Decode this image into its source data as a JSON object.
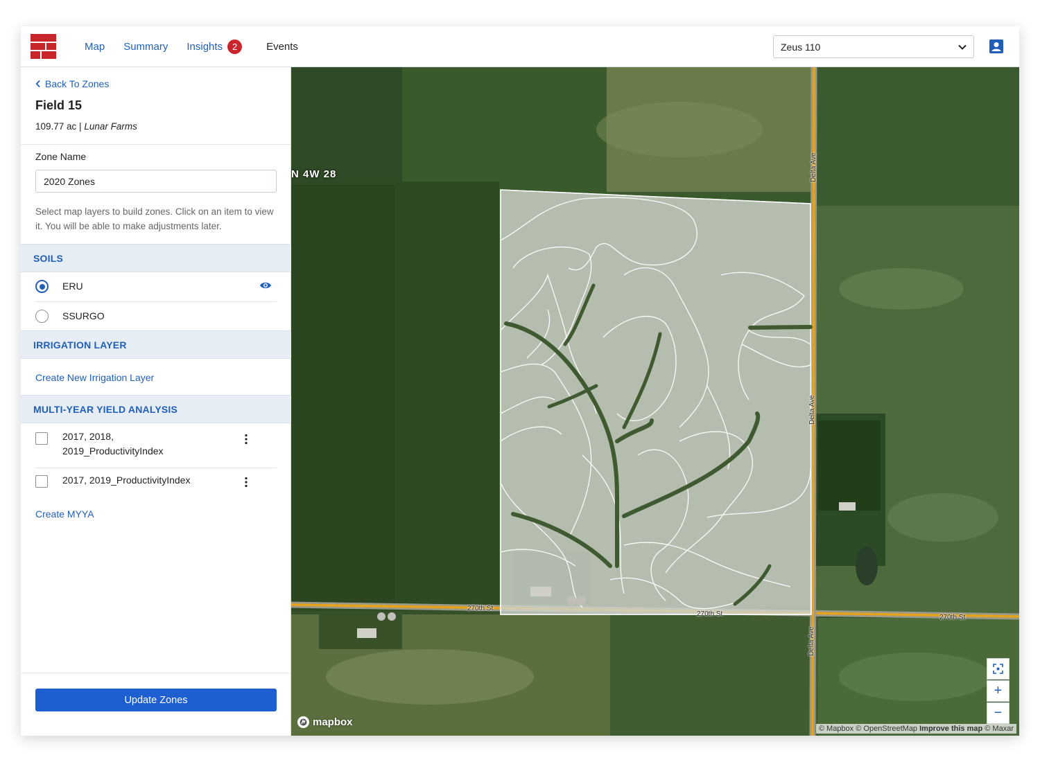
{
  "nav": {
    "items": [
      {
        "label": "Map"
      },
      {
        "label": "Summary"
      },
      {
        "label": "Insights",
        "badge": "2"
      },
      {
        "label": "Events"
      }
    ],
    "farm_select": "Zeus 110"
  },
  "panel": {
    "back_label": "Back To Zones",
    "field_title": "Field 15",
    "field_acres": "109.77 ac |",
    "field_farm": "Lunar Farms",
    "zone_name_label": "Zone Name",
    "zone_name_value": "2020 Zones",
    "help_text": "Select map layers to build zones. Click on an item to view it. You will be able to make adjustments later.",
    "soils": {
      "heading": "SOILS",
      "items": [
        {
          "label": "ERU",
          "selected": true
        },
        {
          "label": "SSURGO",
          "selected": false
        }
      ]
    },
    "irrigation": {
      "heading": "IRRIGATION LAYER",
      "create_label": "Create New Irrigation Layer"
    },
    "myya": {
      "heading": "MULTI-YEAR YIELD ANALYSIS",
      "items": [
        {
          "line1": "2017, 2018,",
          "line2": "2019_ProductivityIndex",
          "checked": false
        },
        {
          "line1": "2017, 2019_ProductivityIndex",
          "checked": false
        }
      ],
      "create_label": "Create MYYA"
    },
    "update_button": "Update Zones"
  },
  "map": {
    "section_label": "N 4W 28",
    "road_labels": {
      "h1": "270th St",
      "h2": "270th St",
      "h3": "270th St",
      "v1": "Delta Ave",
      "v2": "Delta Ave",
      "v3": "Delta Ave"
    },
    "controls": {
      "fit": "fit-icon",
      "zoom_in": "+",
      "zoom_out": "−"
    },
    "logo": "mapbox",
    "attribution": {
      "mapbox": "© Mapbox",
      "osm": "© OpenStreetMap",
      "improve": "Improve this map",
      "maxar": "© Maxar"
    }
  },
  "colors": {
    "accent": "#1f5fb8",
    "primary_button": "#1d5fd0",
    "badge": "#c8262a",
    "brand": "#c8262a",
    "road": "#e8a21a"
  }
}
